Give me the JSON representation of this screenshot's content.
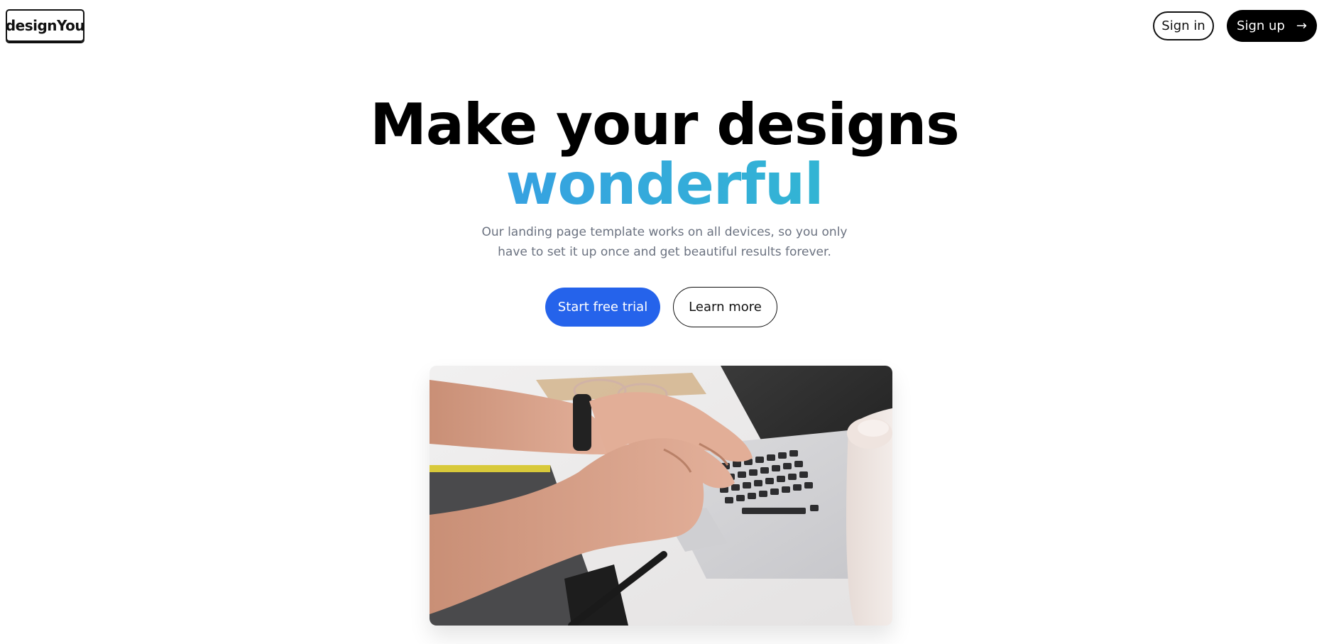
{
  "header": {
    "logo_text": "designYou",
    "signin_label": "Sign in",
    "signup_label": "Sign up",
    "signup_icon": "arrow-right-icon"
  },
  "hero": {
    "title_line1": "Make your designs",
    "title_line2": "wonderful",
    "gradient_colors": [
      "#3b82f6",
      "#2dd4bf"
    ],
    "subtitle_line1": "Our landing page template works on all devices, so you only",
    "subtitle_line2": "have to set it up once and get beautiful results forever.",
    "primary_cta_label": "Start free trial",
    "secondary_cta_label": "Learn more"
  },
  "colors": {
    "primary": "#2563eb",
    "text_dark": "#000000",
    "text_muted": "#6b7280",
    "background": "#ffffff"
  }
}
